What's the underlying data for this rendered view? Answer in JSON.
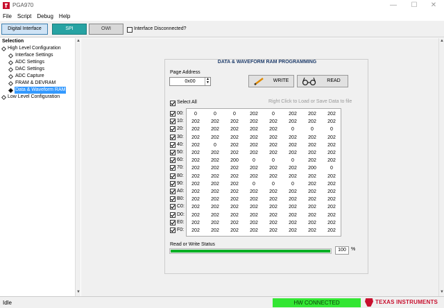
{
  "window": {
    "title": "PGA970"
  },
  "menu": [
    "File",
    "Script",
    "Debug",
    "Help"
  ],
  "toolbar": {
    "digital_interface": "Digital Interface",
    "spi": "SPI",
    "owi": "OWI",
    "disconnected_label": "Interface Disconnected?"
  },
  "sidebar": {
    "title": "Selection",
    "items": [
      {
        "label": "High Level Configuration",
        "level": 0,
        "selected": false
      },
      {
        "label": "Interface Settings",
        "level": 1,
        "selected": false
      },
      {
        "label": "ADC Settings",
        "level": 1,
        "selected": false
      },
      {
        "label": "DAC Settings",
        "level": 1,
        "selected": false
      },
      {
        "label": "ADC Capture",
        "level": 1,
        "selected": false
      },
      {
        "label": "FRAM & DEVRAM",
        "level": 1,
        "selected": false
      },
      {
        "label": "Data & Waveform RAM",
        "level": 1,
        "selected": true
      },
      {
        "label": "Low Level Configuration",
        "level": 0,
        "selected": false
      }
    ]
  },
  "panel": {
    "title": "DATA & WAVEFORM RAM PROGRAMMING",
    "page_address_label": "Page Address",
    "page_address_value": "0x00",
    "write_label": "WRITE",
    "read_label": "READ",
    "select_all_label": "Select All",
    "hint": "Right Click to Load or Save Data to file",
    "rows": [
      {
        "label": "00:",
        "values": [
          "0",
          "0",
          "0",
          "202",
          "0",
          "202",
          "202",
          "202"
        ]
      },
      {
        "label": "10:",
        "values": [
          "202",
          "202",
          "202",
          "202",
          "202",
          "202",
          "202",
          "202"
        ]
      },
      {
        "label": "20:",
        "values": [
          "202",
          "202",
          "202",
          "202",
          "202",
          "0",
          "0",
          "0"
        ]
      },
      {
        "label": "30:",
        "values": [
          "202",
          "202",
          "202",
          "202",
          "202",
          "202",
          "202",
          "202"
        ]
      },
      {
        "label": "40:",
        "values": [
          "202",
          "0",
          "202",
          "202",
          "202",
          "202",
          "202",
          "202"
        ]
      },
      {
        "label": "50:",
        "values": [
          "202",
          "202",
          "202",
          "202",
          "202",
          "202",
          "202",
          "202"
        ]
      },
      {
        "label": "60:",
        "values": [
          "202",
          "202",
          "200",
          "0",
          "0",
          "0",
          "202",
          "202"
        ]
      },
      {
        "label": "70:",
        "values": [
          "202",
          "202",
          "202",
          "202",
          "202",
          "202",
          "200",
          "0"
        ]
      },
      {
        "label": "80:",
        "values": [
          "202",
          "202",
          "202",
          "202",
          "202",
          "202",
          "202",
          "202"
        ]
      },
      {
        "label": "90:",
        "values": [
          "202",
          "202",
          "202",
          "0",
          "0",
          "0",
          "202",
          "202"
        ]
      },
      {
        "label": "A0:",
        "values": [
          "202",
          "202",
          "202",
          "202",
          "202",
          "202",
          "202",
          "202"
        ]
      },
      {
        "label": "B0:",
        "values": [
          "202",
          "202",
          "202",
          "202",
          "202",
          "202",
          "202",
          "202"
        ]
      },
      {
        "label": "C0:",
        "values": [
          "202",
          "202",
          "202",
          "202",
          "202",
          "202",
          "202",
          "202"
        ]
      },
      {
        "label": "D0:",
        "values": [
          "202",
          "202",
          "202",
          "202",
          "202",
          "202",
          "202",
          "202"
        ]
      },
      {
        "label": "E0:",
        "values": [
          "202",
          "202",
          "202",
          "202",
          "202",
          "202",
          "202",
          "202"
        ]
      },
      {
        "label": "F0:",
        "values": [
          "202",
          "202",
          "202",
          "202",
          "202",
          "202",
          "202",
          "202"
        ]
      }
    ],
    "status_label": "Read or Write Status",
    "progress": 100,
    "progress_text": "100",
    "percent_sign": "%"
  },
  "statusbar": {
    "left": "Idle",
    "connection": "HW CONNECTED",
    "brand": "TEXAS INSTRUMENTS"
  },
  "colors": {
    "spi_active": "#27a3a3",
    "progress": "#06b025",
    "connected": "#33e633",
    "ti_red": "#c8102e"
  }
}
